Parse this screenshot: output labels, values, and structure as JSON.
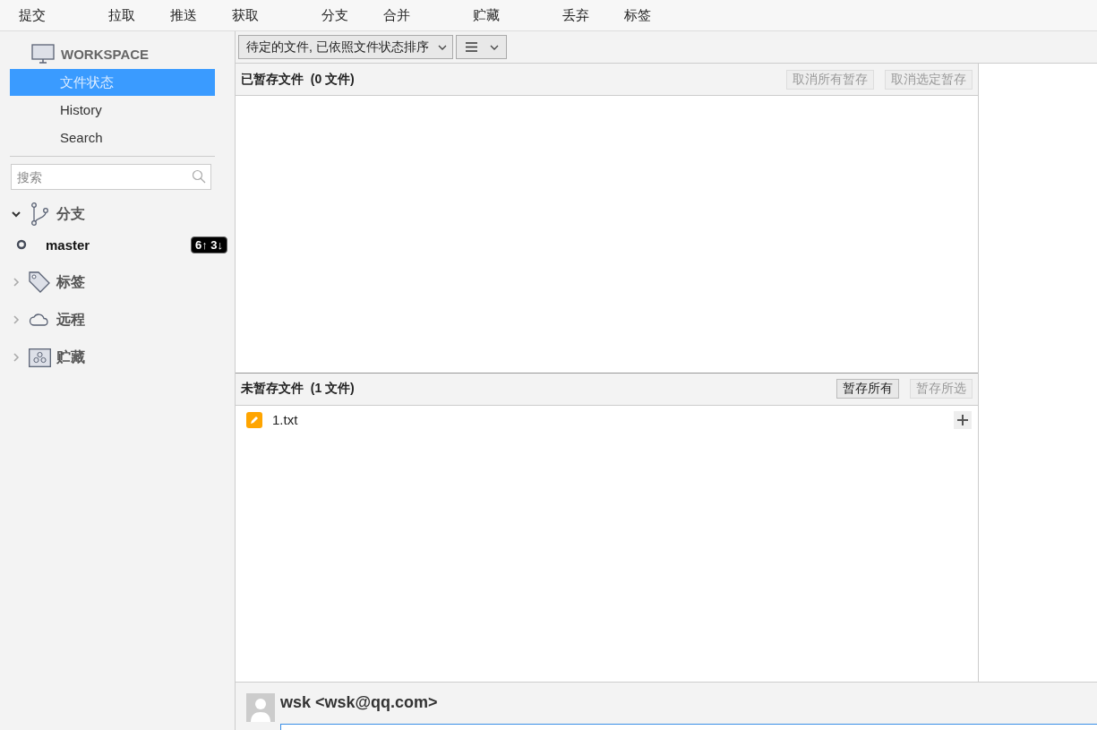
{
  "toolbar": {
    "groups": [
      [
        "提交"
      ],
      [
        "拉取",
        "推送",
        "获取"
      ],
      [
        "分支",
        "合并"
      ],
      [
        "贮藏"
      ],
      [
        "丢弃",
        "标签"
      ]
    ]
  },
  "sidebar": {
    "workspace": {
      "title": "WORKSPACE"
    },
    "nav": [
      {
        "label": "文件状态",
        "selected": true
      },
      {
        "label": "History",
        "selected": false
      },
      {
        "label": "Search",
        "selected": false
      }
    ],
    "search": {
      "placeholder": "搜索"
    },
    "sections": [
      {
        "kind": "branches",
        "label": "分支",
        "expanded": true,
        "children": [
          {
            "label": "master",
            "badge": "6↑ 3↓"
          }
        ]
      },
      {
        "kind": "tags",
        "label": "标签",
        "expanded": false
      },
      {
        "kind": "remotes",
        "label": "远程",
        "expanded": false
      },
      {
        "kind": "stashes",
        "label": "贮藏",
        "expanded": false
      }
    ]
  },
  "filter": {
    "dropdown": "待定的文件, 已依照文件状态排序"
  },
  "staged": {
    "title": "已暂存文件  (0 文件)",
    "buttons": [
      {
        "label": "取消所有暂存",
        "disabled": true
      },
      {
        "label": "取消选定暂存",
        "disabled": true
      }
    ]
  },
  "unstaged": {
    "title": "未暂存文件  (1 文件)",
    "buttons": [
      {
        "label": "暂存所有",
        "disabled": false
      },
      {
        "label": "暂存所选",
        "disabled": true
      }
    ],
    "files": [
      {
        "name": "1.txt",
        "kind": "modified"
      }
    ]
  },
  "commit": {
    "author": "wsk <wsk@qq.com>"
  }
}
